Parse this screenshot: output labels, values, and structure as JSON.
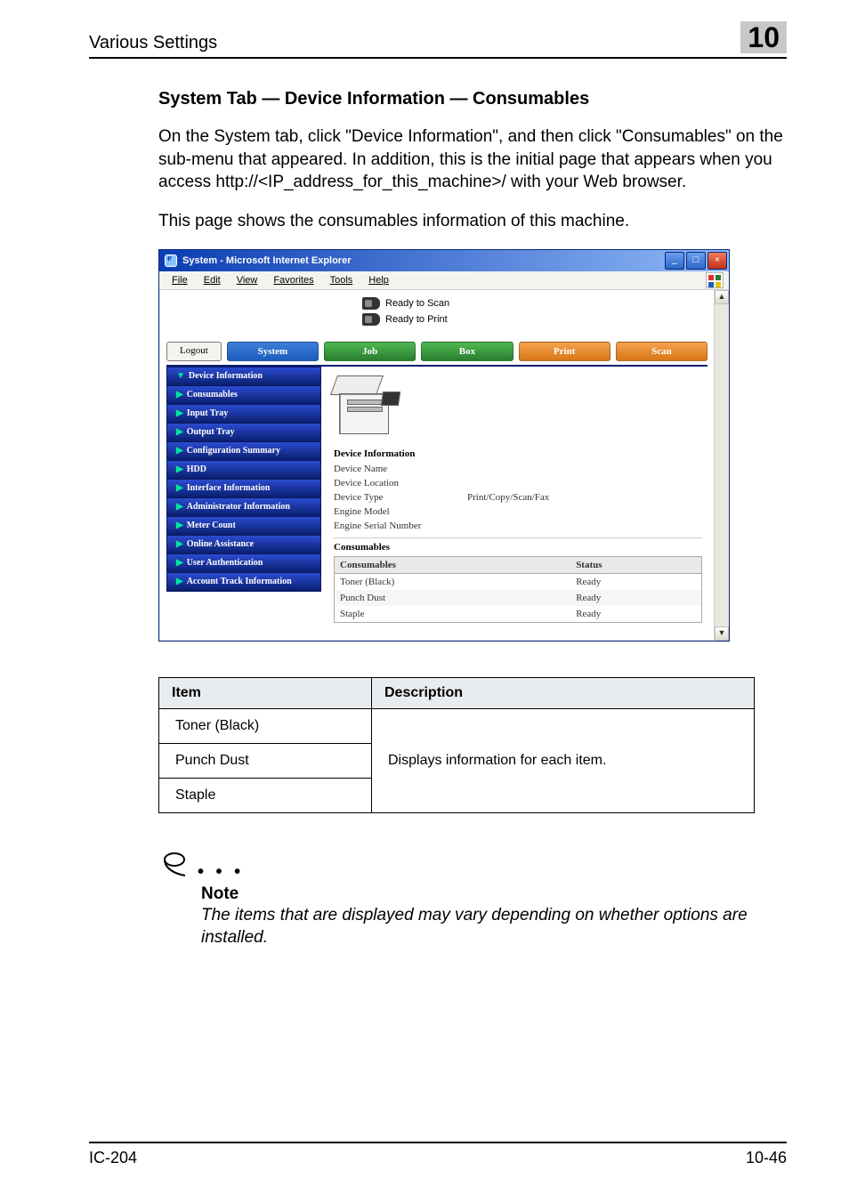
{
  "chapter_no": "10",
  "running_head": "Various Settings",
  "subhead": "System Tab — Device Information — Consumables",
  "para1": "On the System tab, click \"Device Information\", and then click \"Consumables\" on the sub-menu that appeared. In addition, this is the initial page that appears when you access http://<IP_address_for_this_machine>/ with your Web browser.",
  "para2": "This page shows the consumables information of this machine.",
  "ie": {
    "title": "System - Microsoft Internet Explorer",
    "menus": {
      "file": "File",
      "edit": "Edit",
      "view": "View",
      "favorites": "Favorites",
      "tools": "Tools",
      "help": "Help"
    },
    "status": {
      "scan": "Ready to Scan",
      "print": "Ready to Print"
    },
    "logout": "Logout",
    "tabs": {
      "system": "System",
      "job": "Job",
      "box": "Box",
      "print": "Print",
      "scan": "Scan"
    },
    "nav": {
      "device_information": "Device Information",
      "consumables": "Consumables",
      "input_tray": "Input Tray",
      "output_tray": "Output Tray",
      "configuration_summary": "Configuration Summary",
      "hdd": "HDD",
      "interface_information": "Interface Information",
      "administrator_information": "Administrator Information",
      "meter_count": "Meter Count",
      "online_assistance": "Online Assistance",
      "user_authentication": "User Authentication",
      "account_track_information": "Account Track Information"
    },
    "right": {
      "dev_info_title": "Device Information",
      "kv": {
        "device_name_l": "Device Name",
        "device_name_v": "",
        "device_location_l": "Device Location",
        "device_location_v": "",
        "device_type_l": "Device Type",
        "device_type_v": "Print/Copy/Scan/Fax",
        "engine_model_l": "Engine Model",
        "engine_model_v": "",
        "engine_serial_l": "Engine Serial Number",
        "engine_serial_v": ""
      },
      "cons_title": "Consumables",
      "cons_table": {
        "h1": "Consumables",
        "h2": "Status",
        "rows": [
          {
            "name": "Toner (Black)",
            "status": "Ready"
          },
          {
            "name": "Punch Dust",
            "status": "Ready"
          },
          {
            "name": "Staple",
            "status": "Ready"
          }
        ]
      }
    }
  },
  "itemdesc": {
    "h_item": "Item",
    "h_desc": "Description",
    "desc_shared": "Displays information for each item.",
    "rows": [
      "Toner (Black)",
      "Punch Dust",
      "Staple"
    ]
  },
  "note": {
    "label": "Note",
    "text": "The items that are displayed may vary depending on whether options are installed."
  },
  "footer": {
    "left": "IC-204",
    "right": "10-46"
  }
}
